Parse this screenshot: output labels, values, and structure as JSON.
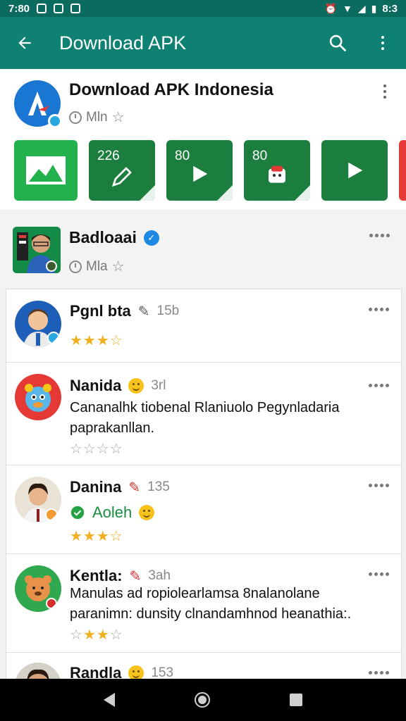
{
  "status_bar": {
    "time": "7:80",
    "right_time": "8:3"
  },
  "app_bar": {
    "title": "Download APK"
  },
  "header": {
    "app_name": "Download APK Indonesia",
    "meta": "Mln",
    "thumbnails": [
      {
        "label": ""
      },
      {
        "label": "226"
      },
      {
        "label": "80"
      },
      {
        "label": "80"
      },
      {
        "label": ""
      }
    ]
  },
  "group": {
    "name": "Badloaai",
    "meta": "Mla"
  },
  "reviews": [
    {
      "name": "Pgnl bta",
      "time": "15b",
      "text": "",
      "badge": "",
      "rating": 4
    },
    {
      "name": "Nanida",
      "time": "3rl",
      "text": "Cananalhk tiobenal Rlaniuolo Pegynladaria paprakanllan.",
      "badge": "",
      "rating": 0
    },
    {
      "name": "Danina",
      "time": "135",
      "text": "",
      "badge": "Aoleh",
      "rating": 4
    },
    {
      "name": "Kentla:",
      "time": "3ah",
      "text": "Manulas ad ropiolearlamsa 8nalanolane paranimn: dunsity clnandamhnod heanathia:.",
      "badge": "",
      "rating": 3
    },
    {
      "name": "Randla",
      "time": "153",
      "text": "",
      "badge": "",
      "rating": 0
    }
  ],
  "icons": {
    "back": "arrow-left-icon",
    "search": "search-icon",
    "more": "more-vertical-icon"
  },
  "colors": {
    "appbar": "#0e8173",
    "statusbar": "#0b6b5f",
    "star": "#f2b01e"
  }
}
